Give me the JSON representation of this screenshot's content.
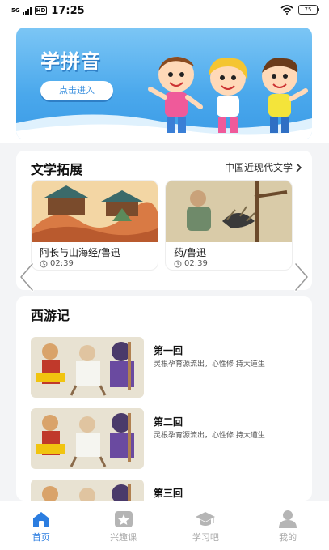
{
  "status_bar": {
    "network": "5G",
    "hd": "HD",
    "time": "17:25",
    "battery": "75"
  },
  "banner": {
    "title": "学拼音",
    "button_label": "点击进入"
  },
  "literature": {
    "title": "文学拓展",
    "link_label": "中国近现代文学",
    "items": [
      {
        "title": "阿长与山海经/鲁迅",
        "duration": "02:39"
      },
      {
        "title": "药/鲁迅",
        "duration": "02:39"
      }
    ]
  },
  "xiyouji": {
    "title": "西游记",
    "chapters": [
      {
        "title": "第一回",
        "desc": "灵根孕育源流出，心性修 持大道生"
      },
      {
        "title": "第二回",
        "desc": "灵根孕育源流出，心性修 持大道生"
      },
      {
        "title": "第三回",
        "desc": ""
      }
    ]
  },
  "nav": {
    "items": [
      {
        "label": "首页",
        "icon": "home-icon",
        "active": true
      },
      {
        "label": "兴趣课",
        "icon": "star-icon",
        "active": false
      },
      {
        "label": "学习吧",
        "icon": "graduation-cap-icon",
        "active": false
      },
      {
        "label": "我的",
        "icon": "user-icon",
        "active": false
      }
    ],
    "active_color": "#2b7de0",
    "inactive_color": "#aaaaaa"
  },
  "colors": {
    "banner_blue": "#4aa8ec",
    "background": "#f3f4f6"
  }
}
